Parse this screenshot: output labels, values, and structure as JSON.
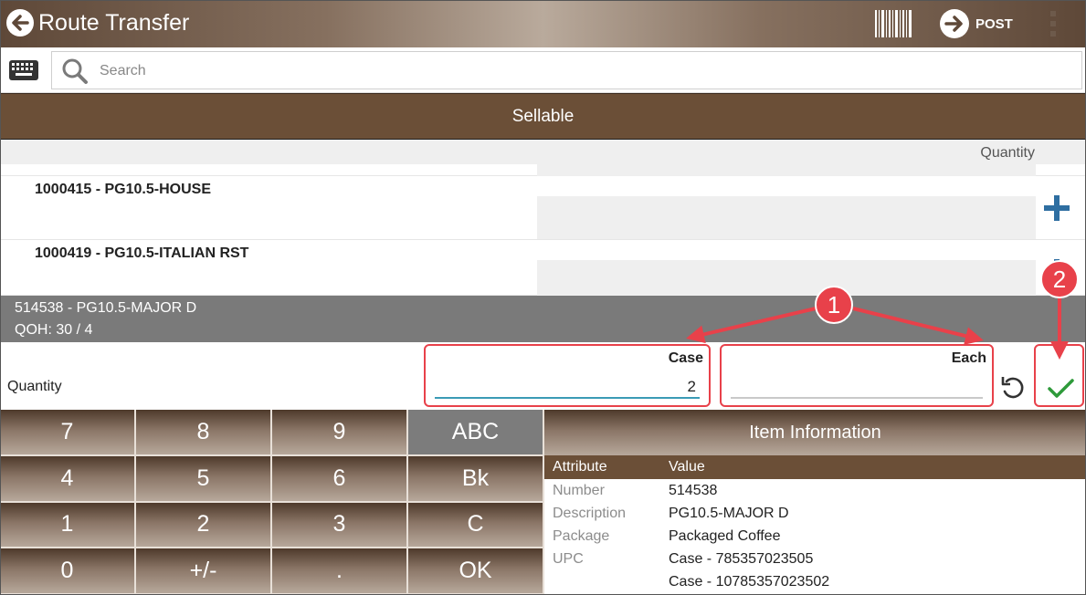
{
  "app": {
    "title": "Route Transfer",
    "post_label": "POST"
  },
  "search": {
    "placeholder": "Search"
  },
  "section": {
    "title": "Sellable",
    "quantity_header": "Quantity"
  },
  "items": [
    {
      "label": "1000415 - PG10.5-HOUSE"
    },
    {
      "label": "1000419 - PG10.5-ITALIAN RST"
    }
  ],
  "selected": {
    "line1": "514538 - PG10.5-MAJOR D",
    "line2": "QOH: 30 / 4"
  },
  "quantity_entry": {
    "label": "Quantity",
    "case_header": "Case",
    "case_value": "2",
    "each_header": "Each",
    "each_value": ""
  },
  "keypad": {
    "keys": [
      "7",
      "8",
      "9",
      "ABC",
      "4",
      "5",
      "6",
      "Bk",
      "1",
      "2",
      "3",
      "C",
      "0",
      "+/-",
      ".",
      "OK"
    ]
  },
  "item_info": {
    "title": "Item Information",
    "attr_header": "Attribute",
    "value_header": "Value",
    "rows": [
      {
        "attribute": "Number",
        "value": "514538"
      },
      {
        "attribute": "Description",
        "value": "PG10.5-MAJOR D"
      },
      {
        "attribute": "Package",
        "value": "Packaged Coffee"
      },
      {
        "attribute": "UPC",
        "value": "Case - 785357023505"
      },
      {
        "attribute": "",
        "value": "Case - 10785357023502"
      }
    ]
  },
  "annotations": {
    "badge1": "1",
    "badge2": "2"
  },
  "colors": {
    "brown": "#6b4f37",
    "accent_blue": "#2e6ea1",
    "callout_red": "#e8414a",
    "confirm_green": "#2e9a3a"
  },
  "icons": {
    "back": "back-arrow-icon",
    "barcode": "barcode-icon",
    "post": "forward-arrow-icon",
    "menu": "more-vert-icon",
    "keyboard": "keyboard-icon",
    "search": "search-icon",
    "add": "plus-icon",
    "undo": "undo-icon",
    "confirm": "check-icon"
  }
}
